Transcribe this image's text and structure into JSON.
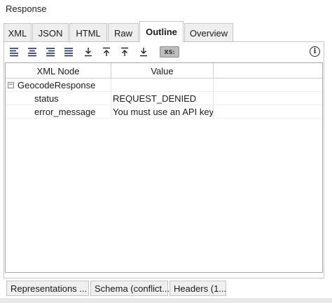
{
  "panel": {
    "title": "Response"
  },
  "tabs": [
    {
      "label": "XML",
      "active": false
    },
    {
      "label": "JSON",
      "active": false
    },
    {
      "label": "HTML",
      "active": false
    },
    {
      "label": "Raw",
      "active": false
    },
    {
      "label": "Outline",
      "active": true
    },
    {
      "label": "Overview",
      "active": false
    }
  ],
  "toolbar": {
    "xs_label": "XS:",
    "info_label": "i",
    "icons": [
      "align-lines-icon",
      "align-lines-icon",
      "align-lines-icon",
      "align-lines-icon",
      "expand-down-icon",
      "collapse-up-icon",
      "move-up-icon",
      "move-down-icon"
    ]
  },
  "grid": {
    "columns": [
      "XML Node",
      "Value",
      ""
    ],
    "rows": [
      {
        "node": "GeocodeResponse",
        "value": "",
        "expander": "−"
      },
      {
        "node": "status",
        "value": "REQUEST_DENIED"
      },
      {
        "node": "error_message",
        "value": "You must use an API key..."
      }
    ]
  },
  "bottom_tabs": [
    {
      "label": "Representations ..."
    },
    {
      "label": "Schema (conflict..."
    },
    {
      "label": "Headers (1..."
    }
  ]
}
